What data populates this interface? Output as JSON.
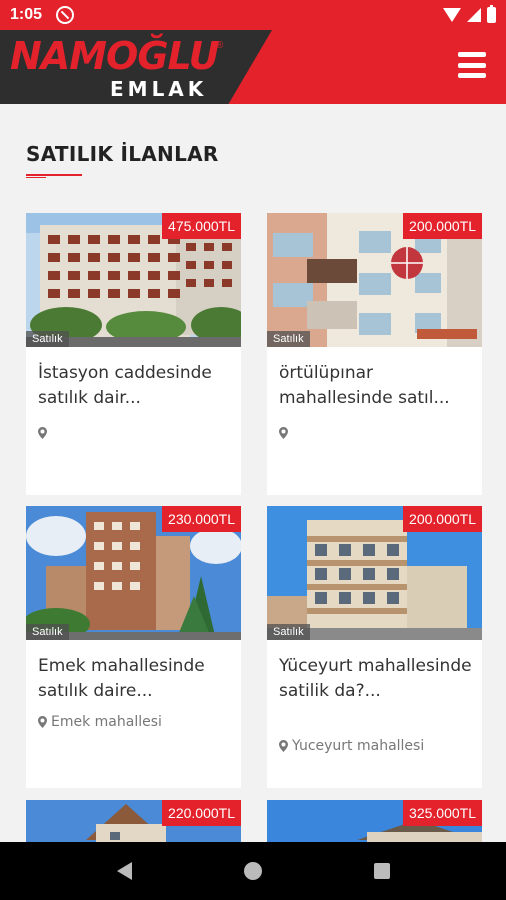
{
  "status_bar": {
    "time": "1:05"
  },
  "header": {
    "logo_main": "NAMOĞLU",
    "logo_reg": "®",
    "logo_sub": "EMLAK",
    "brand_color": "#e3222b"
  },
  "page": {
    "title": "SATILIK İLANLAR"
  },
  "listings": [
    {
      "price": "475.000TL",
      "status": "Satılık",
      "title": "İstasyon caddesinde satılık dair...",
      "location": ""
    },
    {
      "price": "200.000TL",
      "status": "Satılık",
      "title": "örtülüpınar mahallesinde satıl...",
      "location": ""
    },
    {
      "price": "230.000TL",
      "status": "Satılık",
      "title": "Emek mahallesinde satılık daire...",
      "location": "Emek mahallesi"
    },
    {
      "price": "200.000TL",
      "status": "Satılık",
      "title": "Yüceyurt mahallesinde satilik da?...",
      "location": "Yuceyurt mahallesi"
    },
    {
      "price": "220.000TL",
      "status": "",
      "title": "",
      "location": ""
    },
    {
      "price": "325.000TL",
      "status": "",
      "title": "",
      "location": ""
    }
  ]
}
